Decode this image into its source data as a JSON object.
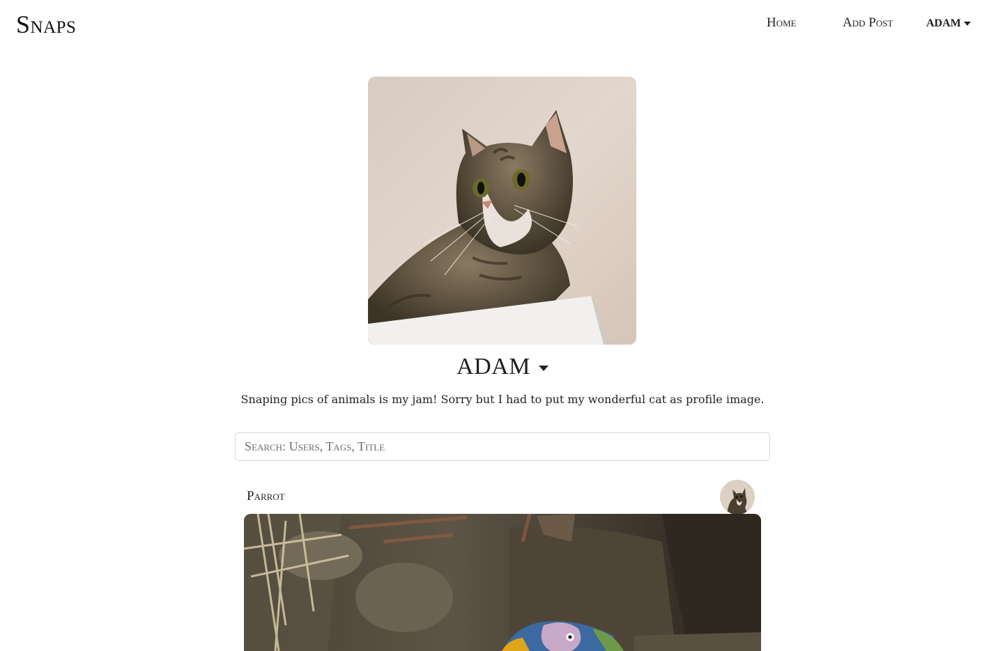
{
  "navbar": {
    "brand": "Snaps",
    "home_label": "Home",
    "add_post_label": "Add Post",
    "user_label": "ADAM"
  },
  "profile": {
    "name": "ADAM",
    "bio": "Snaping pics of animals is my jam! Sorry but I had to put my wonderful cat as profile image."
  },
  "search": {
    "placeholder": "Search: Users, Tags, Title",
    "value": ""
  },
  "posts": [
    {
      "title": "Parrot"
    }
  ]
}
